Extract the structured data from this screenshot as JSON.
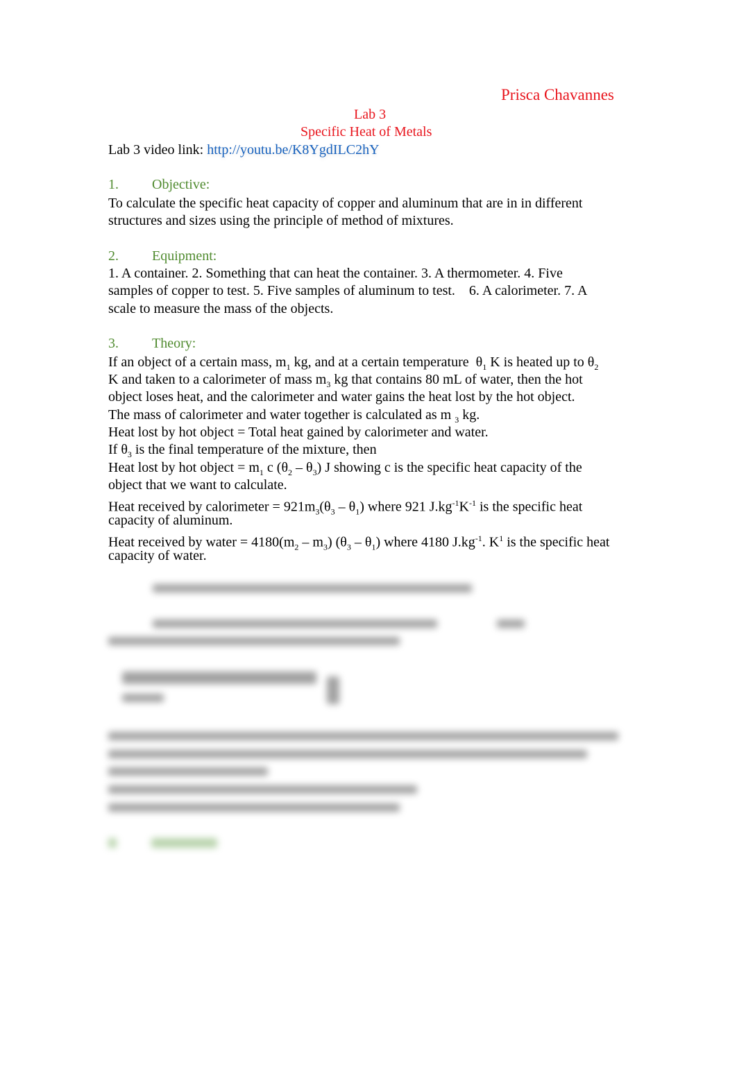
{
  "header": {
    "author": "Prisca Chavannes",
    "lab": "Lab 3",
    "title": "Specific Heat of Metals",
    "video_label": "Lab 3 video link:",
    "video_url": "http://youtu.be/K8YgdILC2hY"
  },
  "sections": [
    {
      "num": "1.",
      "heading": "Objective:",
      "lines": [
        "To calculate the specific heat capacity of copper and aluminum that are in in different",
        "structures and sizes using the principle of method of mixtures."
      ]
    },
    {
      "num": "2.",
      "heading": "Equipment:",
      "lines": [
        "1. A container. 2. Something that can heat the container. 3. A thermometer. 4. Five",
        "samples of copper to test. 5. Five samples of aluminum to test.    6. A calorimeter. 7. A",
        "scale to measure the mass of the objects."
      ]
    },
    {
      "num": "3.",
      "heading": "Theory:"
    }
  ],
  "theory": {
    "l1a": "If an object of a certain mass, m",
    "l1b": " kg, and at a certain temperature  θ",
    "l1c": " K is heated up to θ",
    "l2a": "K and taken to a calorimeter of mass m",
    "l2b": " kg that contains 80 mL of water, then the hot",
    "l3": "object loses heat, and the calorimeter and water gains the heat lost by the hot object.",
    "l4a": "The mass of calorimeter and water together is calculated as m ",
    "l4b": " kg.",
    "l5": "Heat lost by hot object = Total heat gained by calorimeter and water.",
    "l6a": "If θ",
    "l6b": " is the final temperature of the mixture, then",
    "l7a": "Heat lost by hot object = m",
    "l7b": " c (θ",
    "l7c": " – θ",
    "l7d": ") J showing c is the specific heat capacity of the",
    "l8": "object that we want to calculate.",
    "l9a": "Heat received by calorimeter = 921m",
    "l9b": "(θ",
    "l9c": " – θ",
    "l9d": ") where 921 J.kg",
    "l9e": "K",
    "l9f": " is the specific heat",
    "l10": "capacity of aluminum.",
    "l11a": "Heat received by water = 4180(m",
    "l11b": " – m",
    "l11c": ") (θ",
    "l11d": " – θ",
    "l11e": ") where 4180 J.kg",
    "l11f": ". K",
    "l11g": " is the specific heat",
    "l12": "capacity of water.",
    "s1": "1",
    "s2": "2",
    "s3": "3",
    "sm1": "-1"
  }
}
